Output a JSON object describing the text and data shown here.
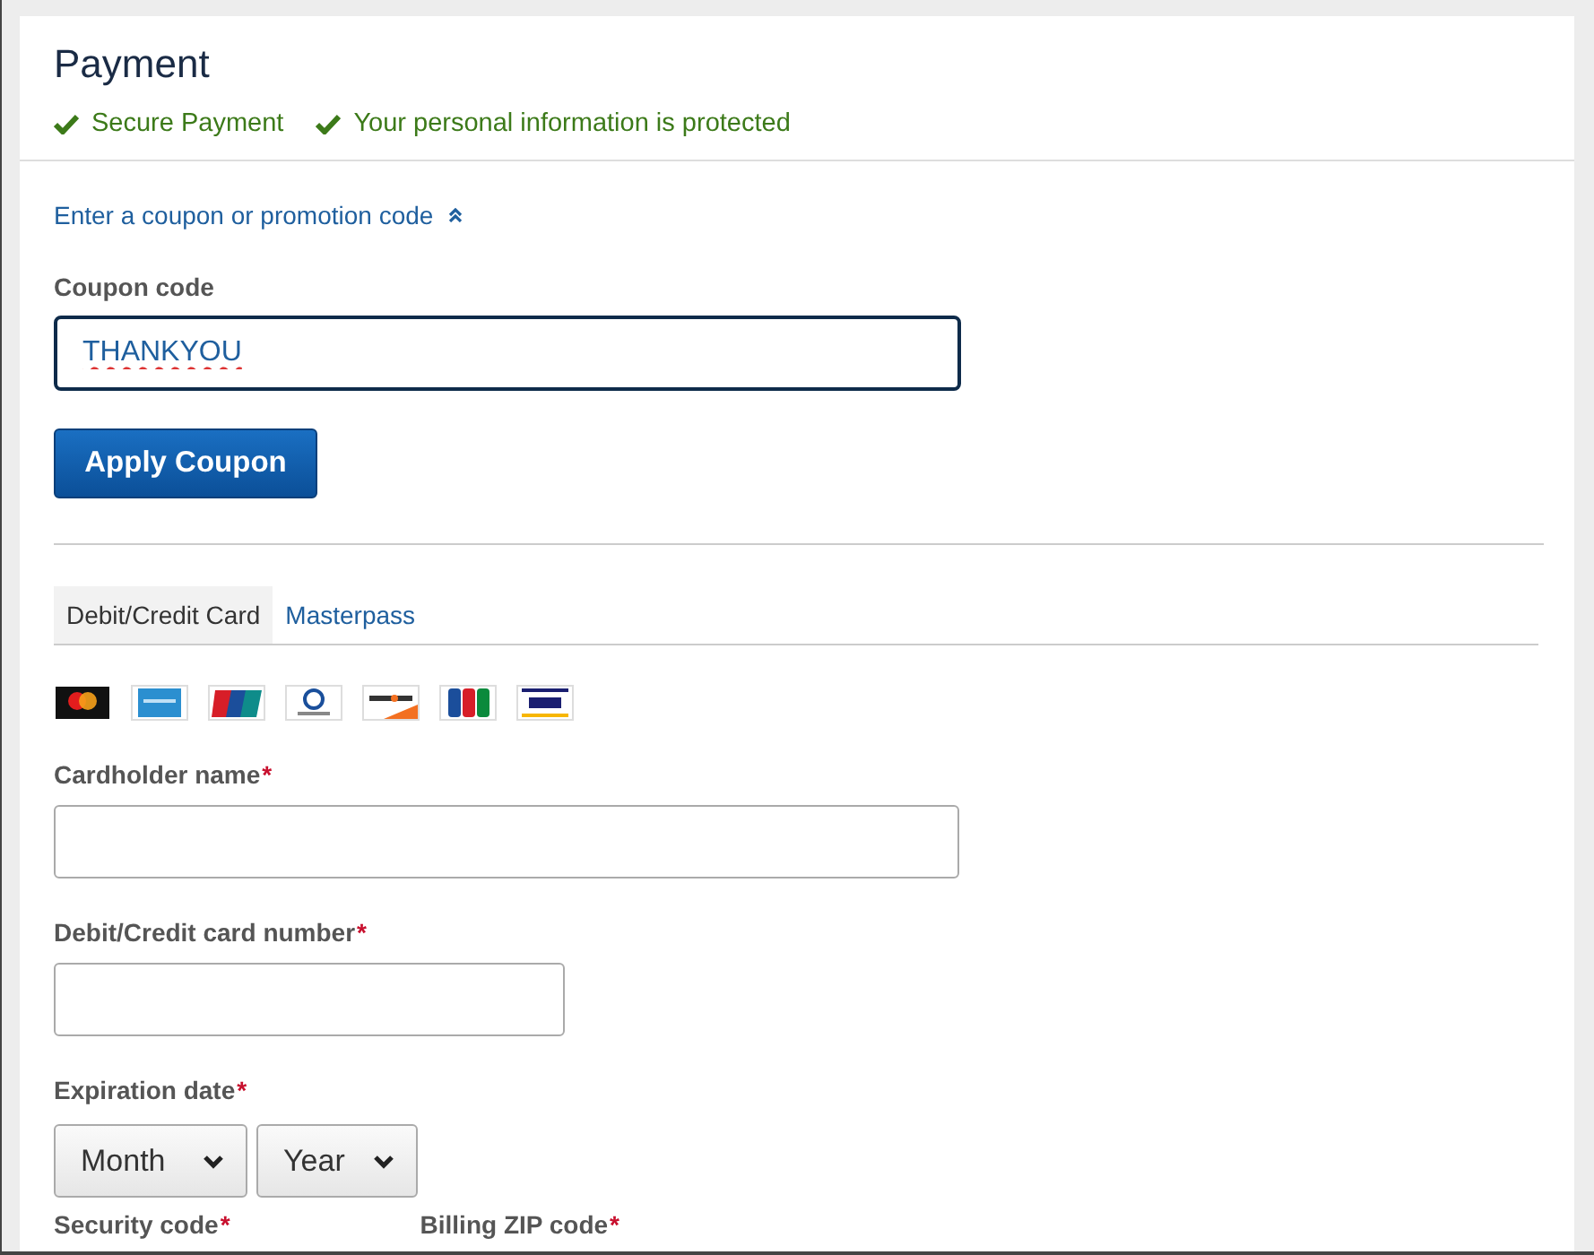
{
  "title": "Payment",
  "assurances": [
    "Secure Payment",
    "Your personal information is protected"
  ],
  "coupon": {
    "toggle": "Enter a coupon or promotion code",
    "expanded": true,
    "label": "Coupon code",
    "value": "THANKYOU",
    "button": "Apply Coupon"
  },
  "tabs": [
    {
      "label": "Debit/Credit Card",
      "selected": true
    },
    {
      "label": "Masterpass",
      "selected": false
    }
  ],
  "card_logos": [
    {
      "kind": "circles"
    },
    {
      "kind": "blue"
    },
    {
      "kind": "red"
    },
    {
      "kind": "round"
    },
    {
      "kind": "stripe"
    },
    {
      "kind": "tricolor"
    },
    {
      "kind": "bands"
    }
  ],
  "required_mark": "*",
  "fields": [
    {
      "label": "Cardholder name",
      "required": true,
      "kind": "wide-text"
    },
    {
      "label": "Debit/Credit card number",
      "required": true,
      "kind": "short-text"
    },
    {
      "label": "Expiration date",
      "required": true,
      "kind": "selects",
      "selects": [
        "Month",
        "Year"
      ]
    }
  ],
  "bottom_labels": [
    {
      "label": "Security code",
      "required": true
    },
    {
      "label": "Billing ZIP code",
      "required": true
    }
  ]
}
